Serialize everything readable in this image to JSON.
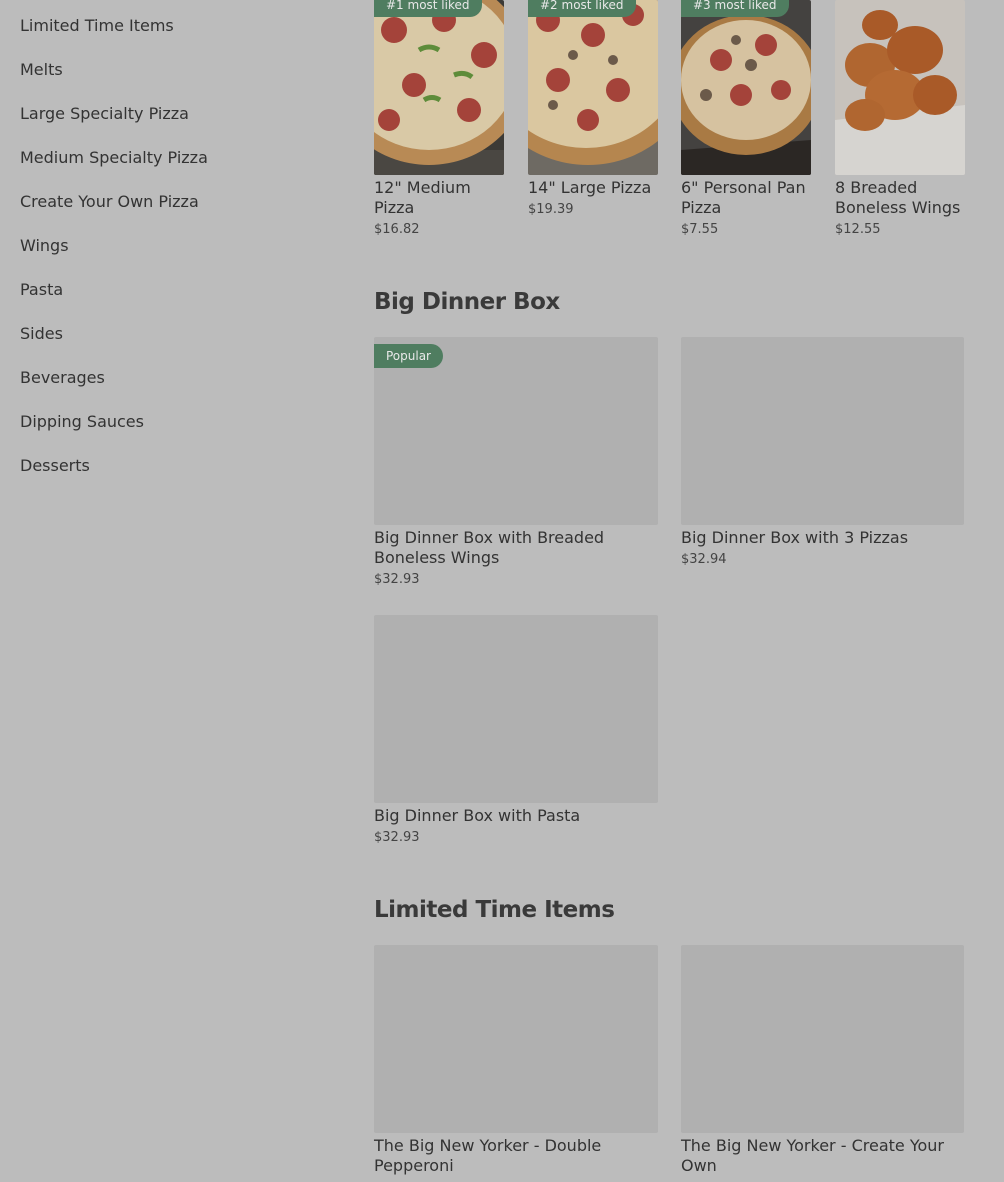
{
  "sidebar": {
    "items": [
      {
        "label": "Limited Time Items"
      },
      {
        "label": "Melts"
      },
      {
        "label": "Large Specialty Pizza"
      },
      {
        "label": "Medium Specialty Pizza"
      },
      {
        "label": "Create Your Own Pizza"
      },
      {
        "label": "Wings"
      },
      {
        "label": "Pasta"
      },
      {
        "label": "Sides"
      },
      {
        "label": "Beverages"
      },
      {
        "label": "Dipping Sauces"
      },
      {
        "label": "Desserts"
      }
    ]
  },
  "most_liked": {
    "items": [
      {
        "badge": "#1 most liked",
        "name": "12\" Medium Pizza",
        "price": "$16.82"
      },
      {
        "badge": "#2 most liked",
        "name": "14\" Large Pizza",
        "price": "$19.39"
      },
      {
        "badge": "#3 most liked",
        "name": "6\" Personal Pan Pizza",
        "price": "$7.55"
      },
      {
        "badge": "",
        "name": "8 Breaded Boneless Wings",
        "price": "$12.55"
      }
    ]
  },
  "big_dinner_box": {
    "title": "Big Dinner Box",
    "items": [
      {
        "badge": "Popular",
        "name": "Big Dinner Box with Breaded Boneless Wings",
        "price": "$32.93"
      },
      {
        "name": "Big Dinner Box with 3 Pizzas",
        "price": "$32.94"
      },
      {
        "name": "Big Dinner Box with Pasta",
        "price": "$32.93"
      }
    ]
  },
  "limited_time": {
    "title": "Limited Time Items",
    "items": [
      {
        "name": "The Big New Yorker - Double Pepperoni"
      },
      {
        "name": "The Big New Yorker - Create Your Own"
      }
    ]
  },
  "colors": {
    "overlay": "#bcbcbc",
    "badge": "#4f7d60",
    "placeholder": "#b0b0b0"
  }
}
